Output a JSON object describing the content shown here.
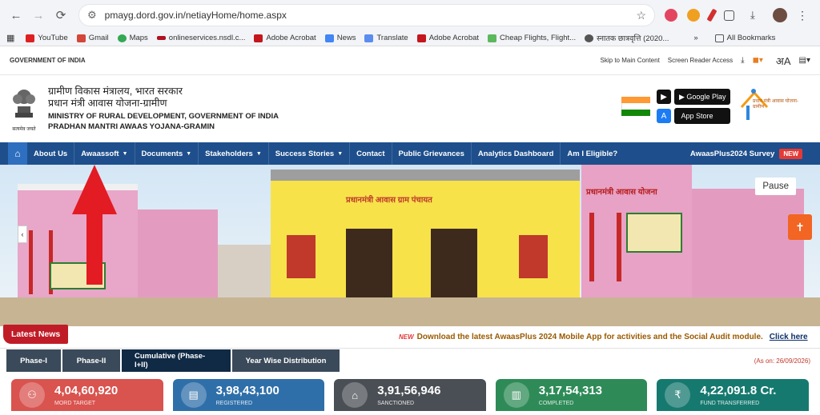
{
  "browser": {
    "url": "pmayg.dord.gov.in/netiayHome/home.aspx",
    "bookmarks": [
      "YouTube",
      "Gmail",
      "Maps",
      "onlineservices.nsdl.c...",
      "Adobe Acrobat",
      "News",
      "Translate",
      "Adobe Acrobat",
      "Cheap Flights, Flight...",
      "स्नातक छात्रवृत्ति (2020..."
    ],
    "all_bookmarks": "All Bookmarks",
    "more": "»"
  },
  "govstrip": {
    "left": "GOVERNMENT OF INDIA",
    "skip": "Skip to Main Content",
    "reader": "Screen Reader Access"
  },
  "header": {
    "hi1": "ग्रामीण विकास मंत्रालय, भारत सरकार",
    "hi2": "प्रधान मंत्री आवास योजना-ग्रामीण",
    "en1": "MINISTRY OF RURAL DEVELOPMENT, GOVERNMENT OF INDIA",
    "en2": "PRADHAN MANTRI AWAAS YOJANA-GRAMIN",
    "emblem_caption": "सत्यमेव जयते",
    "google_play": "Google Play",
    "app_store": "App Store",
    "logo_text": "प्रधान मंत्री आवास योजना-ग्रामीण"
  },
  "nav": {
    "items": [
      {
        "label": "About Us",
        "dropdown": false
      },
      {
        "label": "Awaassoft",
        "dropdown": true
      },
      {
        "label": "Documents",
        "dropdown": true
      },
      {
        "label": "Stakeholders",
        "dropdown": true
      },
      {
        "label": "Success Stories",
        "dropdown": true
      },
      {
        "label": "Contact",
        "dropdown": false
      },
      {
        "label": "Public Grievances",
        "dropdown": false
      },
      {
        "label": "Analytics Dashboard",
        "dropdown": false
      },
      {
        "label": "Am I Eligible?",
        "dropdown": false
      }
    ],
    "survey": "AwaasPlus2024 Survey",
    "new_badge": "NEW"
  },
  "banner": {
    "pause": "Pause",
    "signboard": "प्रधानमंत्री आवास योजना",
    "wall_text": "प्रधानमंत्री आवास ग्राम पंचायत"
  },
  "news": {
    "label": "Latest News",
    "new_tag": "NEW",
    "text": "Download the latest AwaasPlus 2024 Mobile App for activities and the Social Audit module.",
    "link": "Click here"
  },
  "tabs": [
    {
      "label": "Phase-I",
      "active": false
    },
    {
      "label": "Phase-II",
      "active": false
    },
    {
      "label": "Cumulative (Phase-I+II)",
      "active": true
    },
    {
      "label": "Year Wise Distribution",
      "active": false
    }
  ],
  "as_on": "(As on: 26/09/2026)",
  "cards": [
    {
      "value": "4,04,60,920",
      "label": "MORD TARGET",
      "color": "#d9534f",
      "icon": "group-icon"
    },
    {
      "value": "3,98,43,100",
      "label": "REGISTERED",
      "color": "#2f6fa9",
      "icon": "document-icon"
    },
    {
      "value": "3,91,56,946",
      "label": "SANCTIONED",
      "color": "#4a4f55",
      "icon": "house-icon"
    },
    {
      "value": "3,17,54,313",
      "label": "COMPLETED",
      "color": "#2e8b57",
      "icon": "building-icon"
    },
    {
      "value": "4,22,091.8 Cr.",
      "label": "FUND TRANSFERRED",
      "color": "#16796f",
      "icon": "money-icon"
    }
  ],
  "colors": {
    "nav": "#1e4f8c",
    "news_label": "#c01c28",
    "accent": "#f26522"
  }
}
